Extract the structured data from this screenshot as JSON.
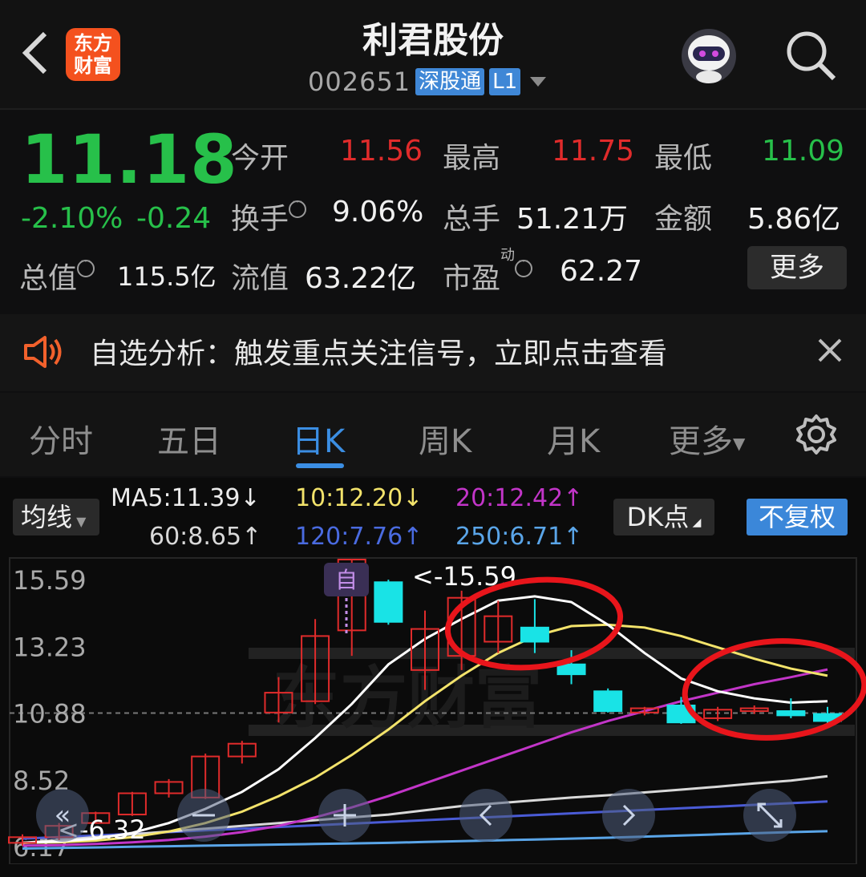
{
  "header": {
    "title": "利君股份",
    "code": "002651",
    "tag_connect": "深股通",
    "tag_level": "L1",
    "logo_line1": "东方",
    "logo_line2": "财富"
  },
  "quote": {
    "price": "11.18",
    "change_pct": "-2.10%",
    "change_abs": "-0.24",
    "open_label": "今开",
    "open": "11.56",
    "high_label": "最高",
    "high": "11.75",
    "low_label": "最低",
    "low": "11.09",
    "turnover_label": "换手",
    "turnover": "9.06%",
    "volume_label": "总手",
    "volume": "51.21万",
    "amount_label": "金额",
    "amount": "5.86亿",
    "total_mv_label": "总值",
    "total_mv": "115.5亿",
    "float_mv_label": "流值",
    "float_mv": "63.22亿",
    "pe_label": "市盈",
    "pe_sup": "动",
    "pe": "62.27",
    "more_label": "更多"
  },
  "notice": {
    "text": "自选分析：触发重点关注信号，立即点击查看"
  },
  "tabs": [
    {
      "label": "分时"
    },
    {
      "label": "五日"
    },
    {
      "label": "日K"
    },
    {
      "label": "周K"
    },
    {
      "label": "月K"
    },
    {
      "label": "更多"
    }
  ],
  "chart_controls": {
    "ma_label": "均线",
    "ma5": "MA5:11.39↓",
    "ma10": "10:12.20↓",
    "ma20": "20:12.42↑",
    "ma60": "60:8.65↑",
    "ma120": "120:7.76↑",
    "ma250": "250:6.71↑",
    "dk_label": "DK点",
    "adjust_label": "不复权",
    "self_marker": "自",
    "high_marker": "<-15.59",
    "low_marker": "<-6.32",
    "ylabel_15": "15.59",
    "ylabel_13": "13.23",
    "ylabel_10": "10.88",
    "ylabel_8": "8.52",
    "ylabel_6": "6.17"
  },
  "colors": {
    "up": "#e02b2b",
    "down": "#27c04a",
    "accent": "#3b8ee3",
    "ma5": "#ffffff",
    "ma10": "#f3e36b",
    "ma20": "#c235c8",
    "ma60": "#d9d9d9",
    "ma120": "#4a5bd6",
    "ma250": "#5aa5e8",
    "annotation": "#e8151b"
  },
  "chart_data": {
    "type": "candlestick",
    "ylim": [
      6.0,
      16.3
    ],
    "yticks": [
      15.59,
      13.23,
      10.88,
      8.52,
      6.17
    ],
    "last_close_line": 10.88,
    "candles": [
      {
        "o": 6.3,
        "c": 6.5,
        "h": 6.6,
        "l": 6.2
      },
      {
        "o": 6.5,
        "c": 6.9,
        "h": 7.0,
        "l": 6.4
      },
      {
        "o": 7.0,
        "c": 7.35,
        "h": 7.4,
        "l": 7.0
      },
      {
        "o": 7.3,
        "c": 8.05,
        "h": 8.1,
        "l": 7.25
      },
      {
        "o": 8.05,
        "c": 8.45,
        "h": 8.55,
        "l": 7.9
      },
      {
        "o": 7.9,
        "c": 9.35,
        "h": 9.45,
        "l": 7.85
      },
      {
        "o": 9.35,
        "c": 9.8,
        "h": 9.9,
        "l": 9.1
      },
      {
        "o": 10.9,
        "c": 11.6,
        "h": 12.15,
        "l": 10.55
      },
      {
        "o": 11.3,
        "c": 13.6,
        "h": 14.2,
        "l": 11.2
      },
      {
        "o": 13.8,
        "c": 16.3,
        "h": 16.3,
        "l": 12.9
      },
      {
        "o": 15.5,
        "c": 14.1,
        "h": 15.59,
        "l": 14.0
      },
      {
        "o": 12.4,
        "c": 13.85,
        "h": 14.5,
        "l": 11.7
      },
      {
        "o": 12.9,
        "c": 14.95,
        "h": 15.2,
        "l": 12.4
      },
      {
        "o": 13.4,
        "c": 14.3,
        "h": 14.85,
        "l": 13.0
      },
      {
        "o": 13.9,
        "c": 13.4,
        "h": 14.9,
        "l": 13.0
      },
      {
        "o": 12.6,
        "c": 12.25,
        "h": 13.1,
        "l": 11.9
      },
      {
        "o": 11.65,
        "c": 10.95,
        "h": 11.75,
        "l": 10.9
      },
      {
        "o": 10.9,
        "c": 11.05,
        "h": 11.1,
        "l": 10.8
      },
      {
        "o": 11.15,
        "c": 10.55,
        "h": 11.45,
        "l": 10.5
      },
      {
        "o": 10.7,
        "c": 11.0,
        "h": 11.1,
        "l": 10.6
      },
      {
        "o": 10.95,
        "c": 11.05,
        "h": 11.15,
        "l": 10.85
      },
      {
        "o": 10.95,
        "c": 10.8,
        "h": 11.4,
        "l": 10.7
      },
      {
        "o": 10.85,
        "c": 10.6,
        "h": 11.1,
        "l": 10.5
      }
    ],
    "ma5": [
      6.3,
      6.35,
      6.45,
      6.65,
      7.0,
      7.5,
      8.1,
      8.9,
      10.0,
      11.2,
      12.6,
      13.5,
      14.2,
      14.85,
      15.0,
      14.8,
      14.0,
      13.0,
      12.1,
      11.65,
      11.4,
      11.25,
      11.3
    ],
    "ma10": [
      6.3,
      6.32,
      6.38,
      6.5,
      6.7,
      7.0,
      7.4,
      7.95,
      8.6,
      9.4,
      10.3,
      11.3,
      12.2,
      13.0,
      13.6,
      13.95,
      14.0,
      13.9,
      13.6,
      13.2,
      12.8,
      12.45,
      12.2
    ],
    "ma20": [
      6.2,
      6.22,
      6.26,
      6.32,
      6.4,
      6.52,
      6.68,
      6.9,
      7.2,
      7.55,
      7.95,
      8.4,
      8.85,
      9.3,
      9.75,
      10.2,
      10.6,
      10.95,
      11.3,
      11.6,
      11.9,
      12.15,
      12.42
    ],
    "ma60": [
      6.3,
      6.4,
      6.5,
      6.6,
      6.7,
      6.8,
      6.9,
      7.0,
      7.1,
      7.2,
      7.3,
      7.45,
      7.6,
      7.7,
      7.8,
      7.9,
      7.98,
      8.08,
      8.18,
      8.28,
      8.4,
      8.5,
      8.65
    ],
    "ma120": [
      6.45,
      6.5,
      6.56,
      6.62,
      6.68,
      6.74,
      6.8,
      6.86,
      6.92,
      6.98,
      7.04,
      7.1,
      7.16,
      7.22,
      7.28,
      7.34,
      7.4,
      7.46,
      7.52,
      7.58,
      7.64,
      7.7,
      7.76
    ],
    "ma250": [
      6.1,
      6.12,
      6.14,
      6.16,
      6.18,
      6.2,
      6.22,
      6.24,
      6.26,
      6.28,
      6.3,
      6.33,
      6.36,
      6.39,
      6.42,
      6.45,
      6.48,
      6.52,
      6.56,
      6.6,
      6.64,
      6.68,
      6.71
    ]
  }
}
